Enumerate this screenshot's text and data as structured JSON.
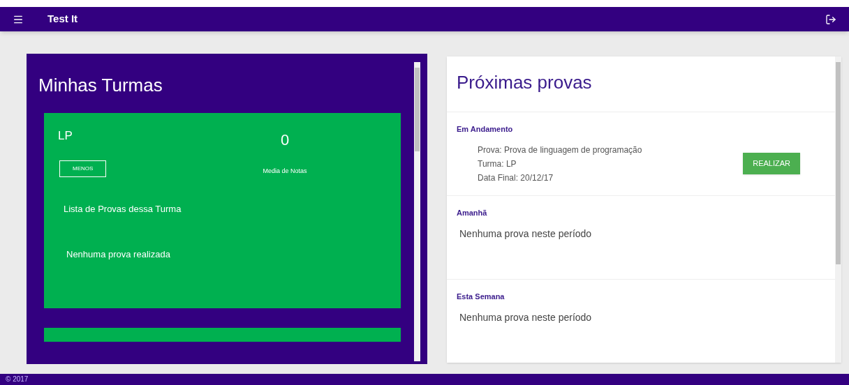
{
  "app_bar": {
    "title": "Test It"
  },
  "turmas": {
    "title": "Minhas Turmas",
    "cards": [
      {
        "name": "LP",
        "average": "0",
        "average_label": "Media de Notas",
        "button": "MENOS",
        "list_title": "Lista de Provas dessa Turma",
        "empty_text": "Nenhuma prova realizada"
      }
    ]
  },
  "provas": {
    "title": "Próximas provas",
    "sections": [
      {
        "heading": "Em Andamento",
        "kind": "items",
        "items": [
          {
            "lines": [
              "Prova: Prova de linguagem de programação",
              "Turma: LP",
              "Data Final: 20/12/17"
            ],
            "button": "REALIZAR"
          }
        ]
      },
      {
        "heading": "Amanhã",
        "kind": "empty",
        "text": "Nenhuma prova neste período"
      },
      {
        "heading": "Esta Semana",
        "kind": "empty",
        "text": "Nenhuma prova neste período"
      }
    ]
  },
  "footer": {
    "text": "© 2017"
  }
}
